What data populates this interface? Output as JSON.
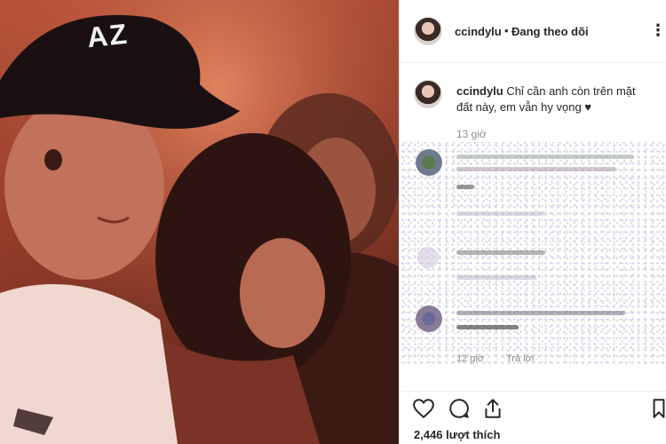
{
  "header": {
    "username": "ccindylu",
    "separator": "•",
    "follow_status": "Đang theo dõi",
    "more_icon": "more-options-icon",
    "more_glyph": "⋮"
  },
  "caption": {
    "username": "ccindylu",
    "text": "Chỉ cần anh còn trên mặt đất này, em vẫn hy vọng ♥",
    "time": "13 giờ"
  },
  "comments": {
    "time": "12 giờ",
    "reply": "Trả lời"
  },
  "actions": {
    "like_icon": "heart-icon",
    "comment_icon": "comment-icon",
    "share_icon": "share-icon",
    "save_icon": "bookmark-icon"
  },
  "likes": {
    "count_text": "2,446 lượt thích"
  },
  "photo": {
    "cap_text": "AZ"
  }
}
